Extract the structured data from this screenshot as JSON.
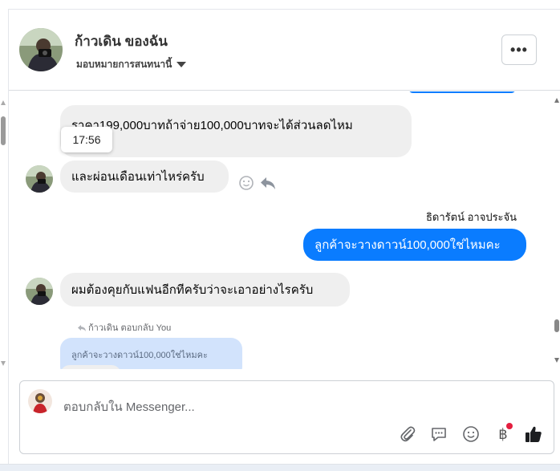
{
  "header": {
    "title": "ก้าวเดิน ของฉัน",
    "subtitle": "มอบหมายการสนทนานี้",
    "more_label": "•••"
  },
  "thread": {
    "messages": [
      {
        "direction": "in",
        "text": "ราคา199,000บาทถ้าจ่าย100,000บาทจะได้ส่วนลดไหม",
        "tooltip_time": "17:56"
      },
      {
        "direction": "in",
        "text": "และผ่อนเดือนเท่าไหร่ครับ"
      },
      {
        "direction": "out",
        "sender": "ธิดารัตน์ อาจประจัน",
        "text": "ลูกค้าจะวางดาวน์100,000ใช่ไหมคะ"
      },
      {
        "direction": "in",
        "text": "ผมต้องคุยกับแฟนอีกทีครับว่าจะเอาอย่างไรครับ"
      }
    ],
    "reply_meta": "ก้าวเดิน ตอบกลับ You",
    "quoted_text": "ลูกค้าจะวางดาวน์100,000ใช่ไหมคะ"
  },
  "composer": {
    "placeholder": "ตอบกลับใน Messenger...",
    "baht_symbol": "฿"
  },
  "colors": {
    "outgoing_bubble": "#0a7cff",
    "incoming_bubble": "#efefef",
    "quoted_bg": "#d2e3fc",
    "notification_dot": "#e41e3f"
  },
  "icons": [
    "paperclip-icon",
    "saved-reply-icon",
    "emoji-icon",
    "baht-icon",
    "like-icon",
    "react-icon",
    "reply-icon",
    "chevron-down-icon"
  ]
}
